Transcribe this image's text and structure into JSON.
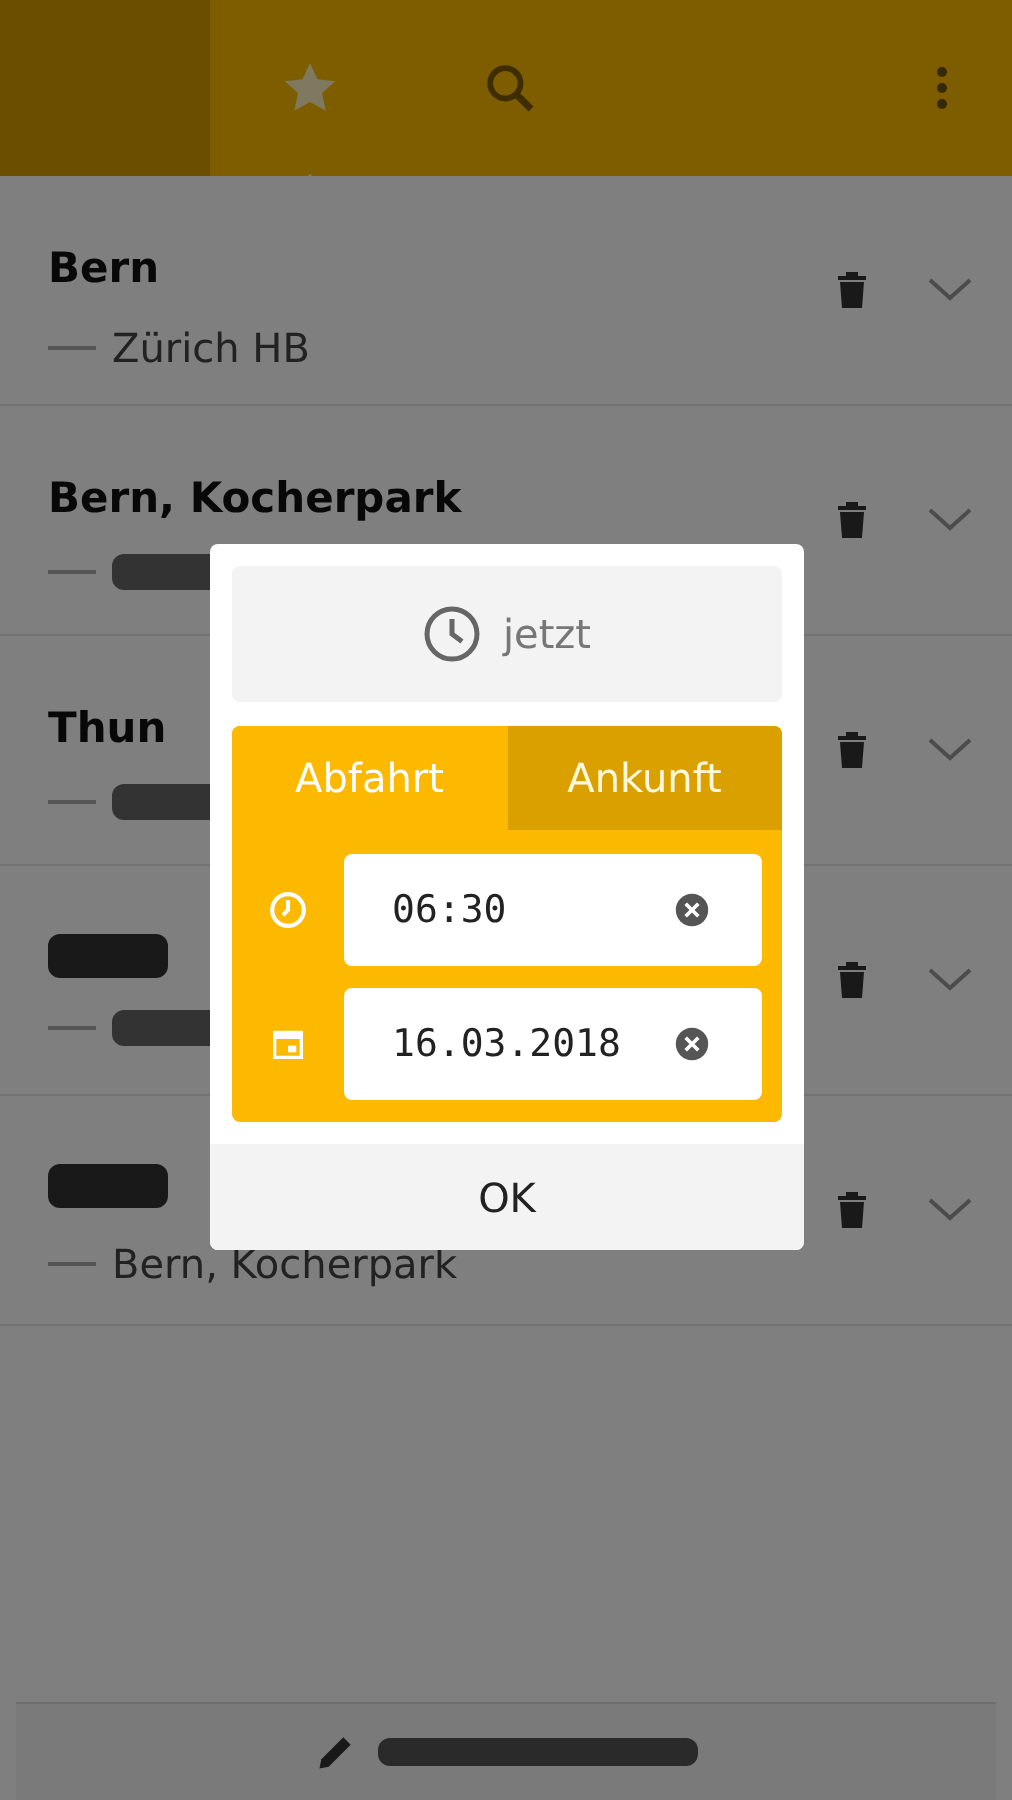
{
  "header": {
    "tabs": [
      {
        "kind": "favorites",
        "selected": true
      },
      {
        "kind": "search",
        "selected": false
      }
    ]
  },
  "rows": [
    {
      "title": "Bern",
      "subtitle": "Zürich HB"
    },
    {
      "title": "Bern, Kocherpark"
    },
    {
      "title": "Thun"
    },
    {},
    {
      "subtitle": "Bern, Kocherpark"
    }
  ],
  "dialog": {
    "now_button": "jetzt",
    "tabs": [
      {
        "label": "Abfahrt",
        "selected": true
      },
      {
        "label": "Ankunft",
        "selected": false
      }
    ],
    "fields": [
      {
        "kind": "time",
        "value": "06:30"
      },
      {
        "kind": "date",
        "value": "16.03.2018"
      }
    ],
    "ok_button": "OK"
  }
}
